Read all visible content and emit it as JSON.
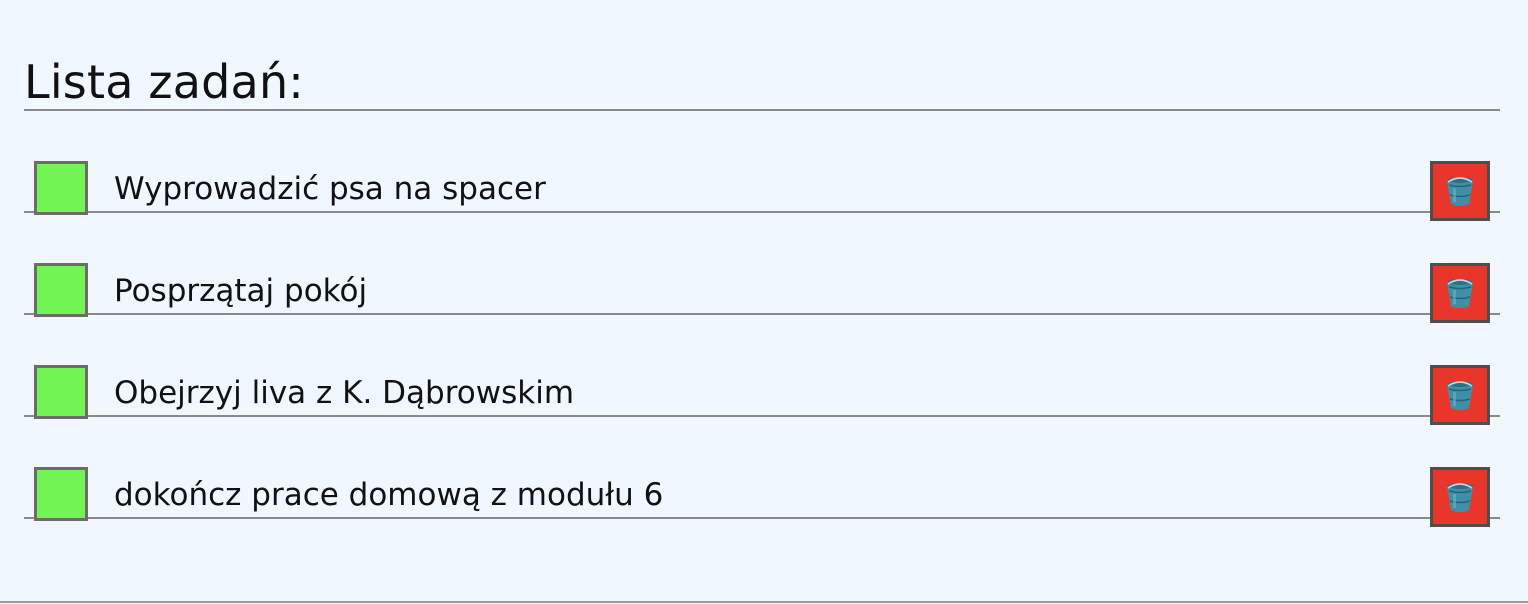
{
  "header": {
    "title": "Lista zadań:"
  },
  "tasks": [
    {
      "text": "Wyprowadzić psa na spacer",
      "checkbox_icon": "green-square"
    },
    {
      "text": "Posprzątaj pokój",
      "checkbox_icon": "green-square"
    },
    {
      "text": "Obejrzyj liva z K. Dąbrowskim",
      "checkbox_icon": "green-square"
    },
    {
      "text": "dokończ prace domową z modułu 6",
      "checkbox_icon": "green-square"
    }
  ],
  "delete_icon": "bucket-icon",
  "colors": {
    "background": "#f0f7ff",
    "checkbox": "#72f455",
    "delete_button": "#e8372a",
    "bucket": "#3f8fa8"
  }
}
